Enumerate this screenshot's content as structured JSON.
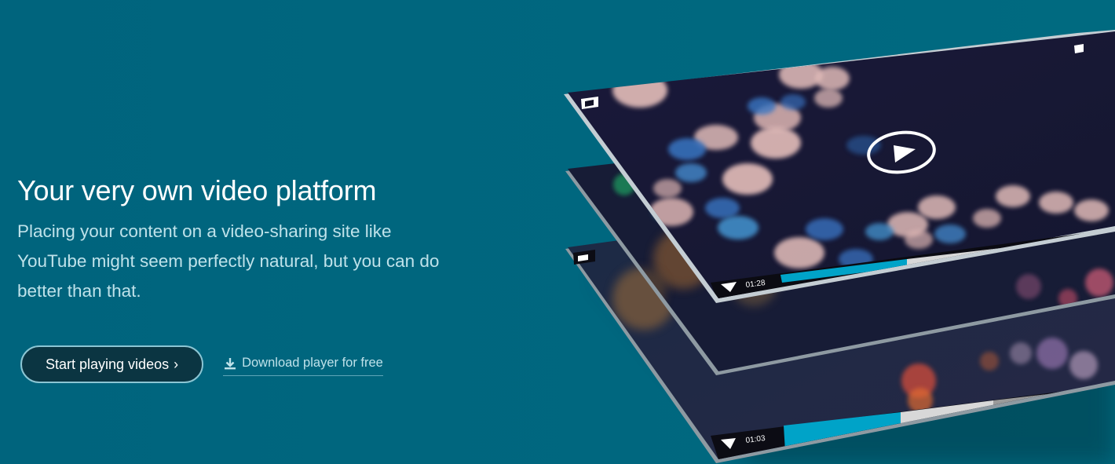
{
  "hero": {
    "title": "Your very own video platform",
    "subtitle": "Placing your content on a video-sharing site like YouTube might seem perfectly natural, but you can do better than that.",
    "cta_label": "Start playing videos",
    "cta_chevron": "›",
    "download_label": "Download player for free"
  },
  "players": {
    "front_time": "01:28",
    "back_time": "01:03",
    "front_progress": 0.34,
    "back_progress": 0.45
  },
  "colors": {
    "background": "#00667f",
    "accent": "#00a3c8",
    "button_bg": "#0b3542"
  }
}
